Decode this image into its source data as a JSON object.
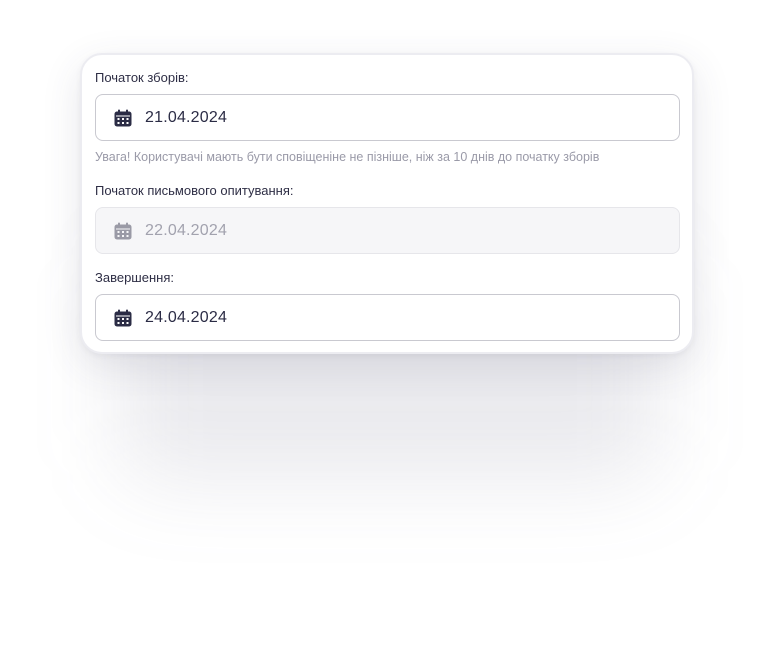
{
  "colors": {
    "icon_active": "#2b2c45",
    "icon_disabled": "#9a9aa6",
    "text_primary": "#2b2c45",
    "text_hint": "#9a9aa8"
  },
  "fields": {
    "collection_start": {
      "label": "Початок зборів:",
      "value": "21.04.2024",
      "icon": "calendar-icon",
      "hint": "Увага! Користувачі мають бути сповіщеніне не пізніше, ніж за 10 днів до початку зборів"
    },
    "written_survey_start": {
      "label": "Початок письмового опитування:",
      "value": "22.04.2024",
      "icon": "calendar-icon",
      "disabled": true
    },
    "completion": {
      "label": "Завершення:",
      "value": "24.04.2024",
      "icon": "calendar-icon"
    }
  }
}
